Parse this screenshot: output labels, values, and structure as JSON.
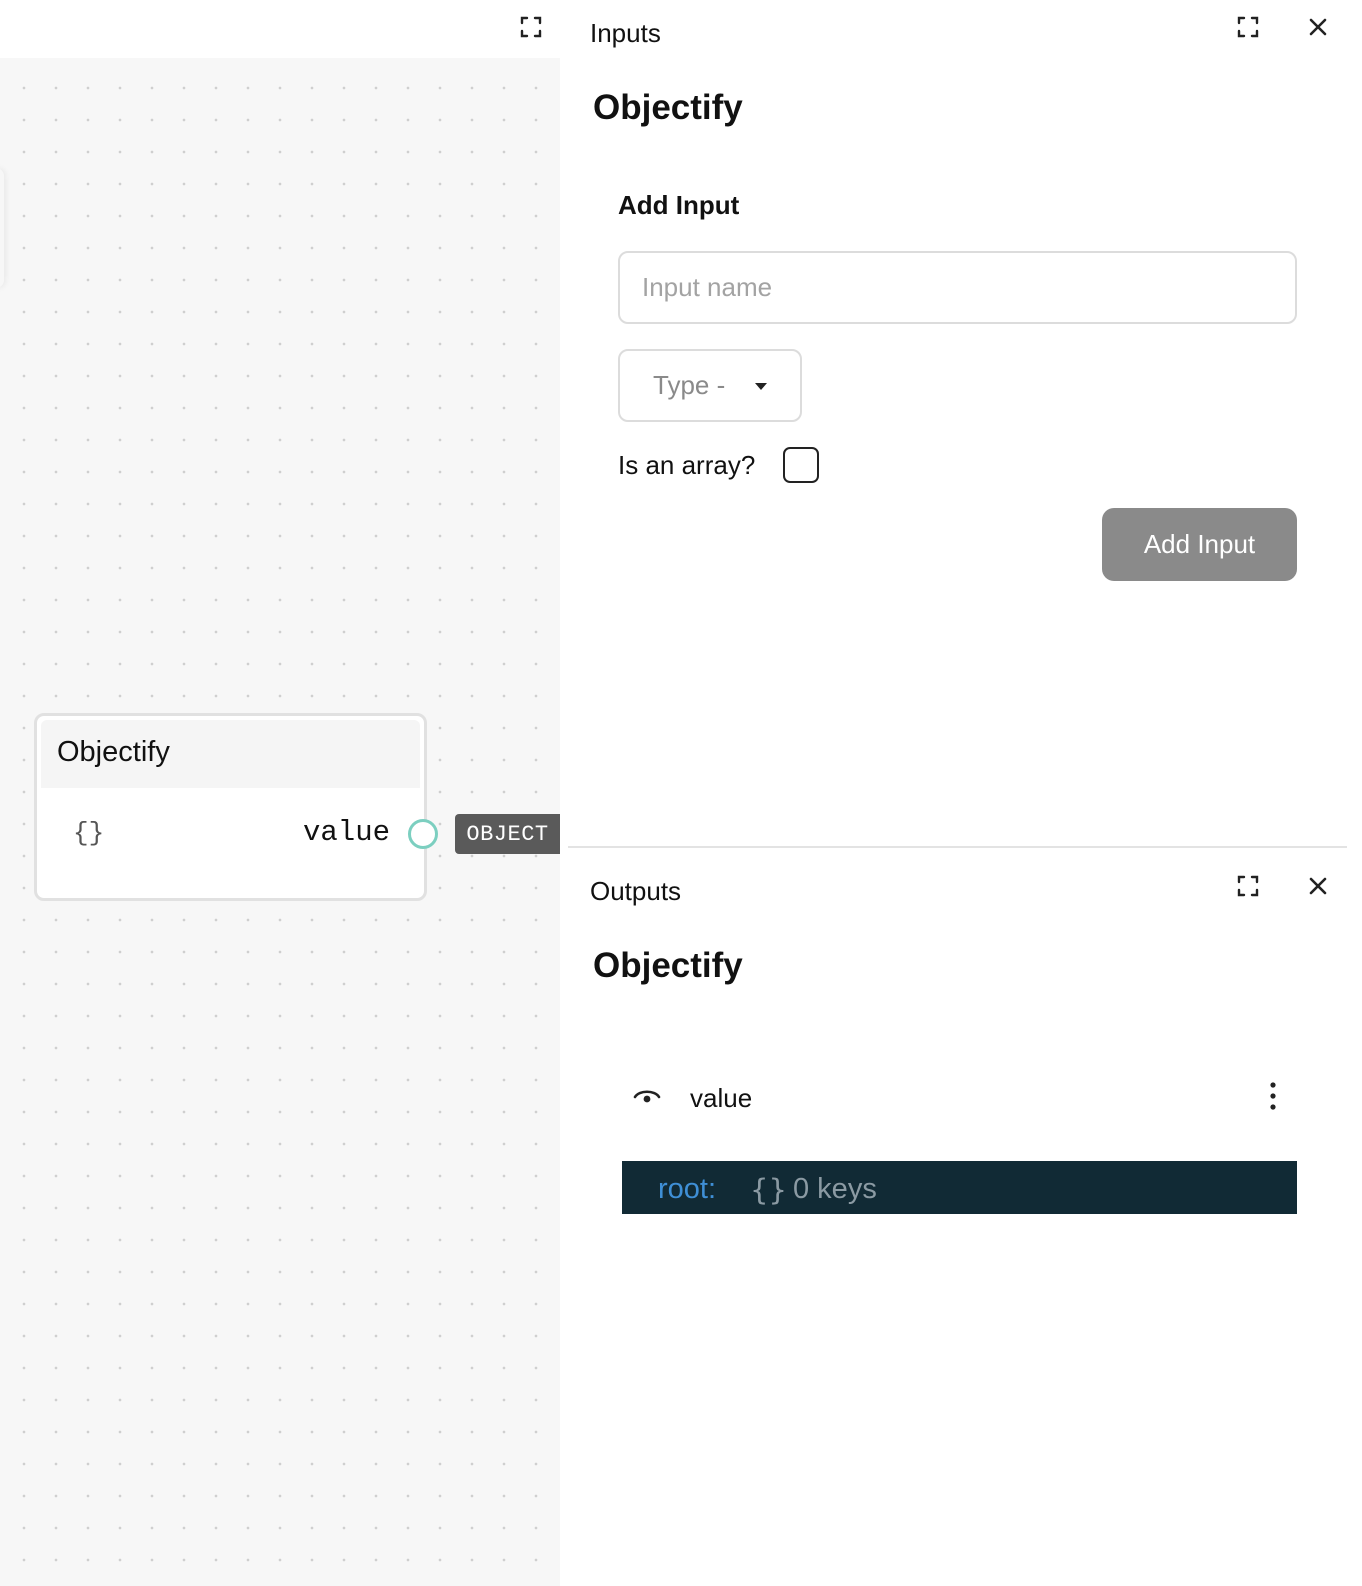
{
  "canvas": {
    "node": {
      "title": "Objectify",
      "type_glyph": "{}",
      "port_label": "value",
      "port_type_badge": "OBJECT"
    }
  },
  "inputs_panel": {
    "label": "Inputs",
    "heading": "Objectify",
    "section_title": "Add Input",
    "input_name": {
      "value": "",
      "placeholder": "Input name"
    },
    "type_select": {
      "selected": "Type -"
    },
    "array_label": "Is an array?",
    "array_checked": false,
    "add_button_label": "Add Input"
  },
  "outputs_panel": {
    "label": "Outputs",
    "heading": "Objectify",
    "outputs": [
      {
        "name": "value",
        "json_viewer": {
          "root_label": "root:",
          "brace": "{}",
          "summary": "0 keys"
        }
      }
    ]
  },
  "icons": {
    "expand": "expand-icon",
    "close": "close-icon",
    "eye": "eye-icon",
    "kebab": "kebab-menu-icon",
    "caret": "caret-down-icon"
  },
  "colors": {
    "port_ring": "#7ccfc0",
    "badge_bg": "#5a5a5a",
    "button_bg": "#8a8a8a",
    "json_bg": "#112a35",
    "json_key": "#3f8fd6",
    "json_muted": "#8b9aa3"
  }
}
